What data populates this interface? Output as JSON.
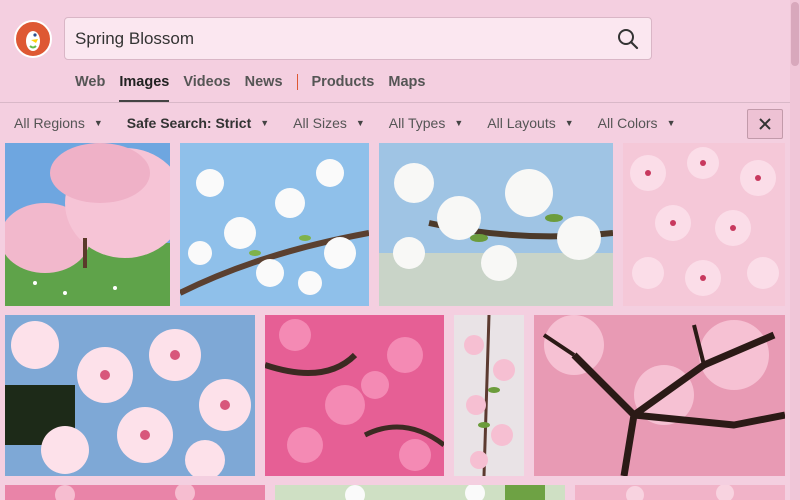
{
  "search": {
    "query": "Spring Blossom"
  },
  "tabs": [
    {
      "label": "Web"
    },
    {
      "label": "Images"
    },
    {
      "label": "Videos"
    },
    {
      "label": "News"
    },
    {
      "label": "Products"
    },
    {
      "label": "Maps"
    }
  ],
  "filters": [
    {
      "label": "All Regions"
    },
    {
      "label": "Safe Search: Strict"
    },
    {
      "label": "All Sizes"
    },
    {
      "label": "All Types"
    },
    {
      "label": "All Layouts"
    },
    {
      "label": "All Colors"
    }
  ],
  "icons": {
    "logo": "duckduckgo-logo-icon",
    "search": "search-icon",
    "caret": "caret-down-icon",
    "close": "close-icon"
  },
  "colors": {
    "background": "#f4cfe0",
    "accent": "#de5833"
  }
}
